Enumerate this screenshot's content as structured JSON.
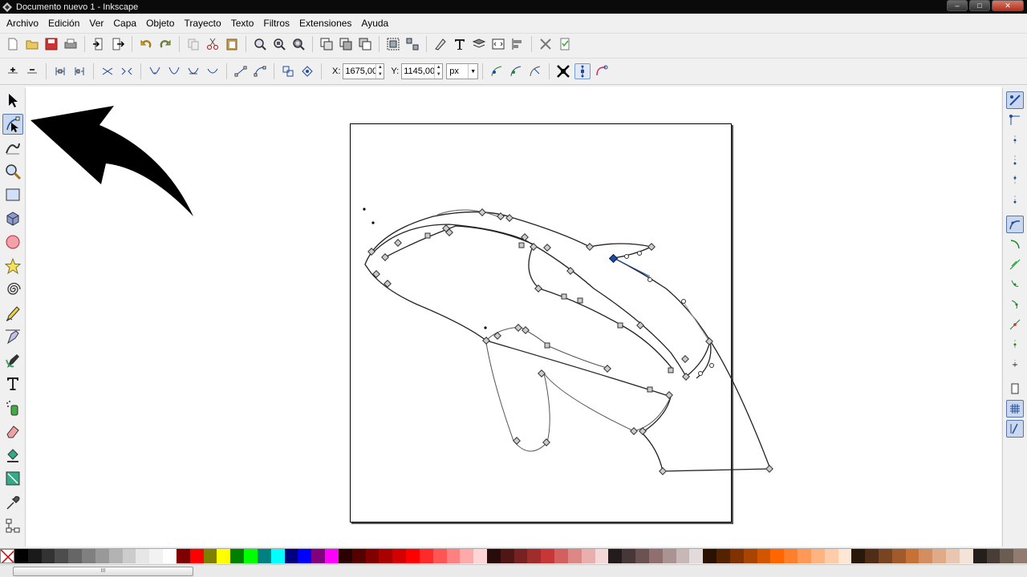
{
  "window": {
    "title": "Documento nuevo 1 - Inkscape",
    "minimize": "‒",
    "maximize": "□",
    "close": "✕"
  },
  "menu": [
    "Archivo",
    "Edición",
    "Ver",
    "Capa",
    "Objeto",
    "Trayecto",
    "Texto",
    "Filtros",
    "Extensiones",
    "Ayuda"
  ],
  "nodebar": {
    "x_label": "X:",
    "x_value": "1675,00",
    "y_label": "Y:",
    "y_value": "1145,00",
    "unit": "px"
  },
  "scrollbar": {
    "grip": "III"
  },
  "colors": {
    "accent": "#1f4a9e",
    "palette": [
      "#000000",
      "#1a1a1a",
      "#333333",
      "#4d4d4d",
      "#666666",
      "#808080",
      "#999999",
      "#b3b3b3",
      "#cccccc",
      "#e6e6e6",
      "#f2f2f2",
      "#ffffff",
      "#800000",
      "#ff0000",
      "#808000",
      "#ffff00",
      "#008000",
      "#00ff00",
      "#008080",
      "#00ffff",
      "#000080",
      "#0000ff",
      "#800080",
      "#ff00ff",
      "#2b0000",
      "#550000",
      "#800000",
      "#aa0000",
      "#d40000",
      "#ff0000",
      "#ff2a2a",
      "#ff5555",
      "#ff8080",
      "#ffaaaa",
      "#ffd5d5",
      "#280b0b",
      "#501616",
      "#782121",
      "#a02c2c",
      "#c83737",
      "#d35f5f",
      "#de8787",
      "#e9afaf",
      "#f4d7d7",
      "#241c1c",
      "#483737",
      "#6c5353",
      "#916f6f",
      "#ac9393",
      "#c8b7b7",
      "#e3dbdb",
      "#2b1100",
      "#552200",
      "#803300",
      "#aa4400",
      "#d45500",
      "#ff6600",
      "#ff7f2a",
      "#ff9955",
      "#ffb380",
      "#ffccaa",
      "#ffe6d5",
      "#28170b",
      "#502d16",
      "#784421",
      "#a05a2c",
      "#c87137",
      "#d38d5f",
      "#deaa87",
      "#e9c6af",
      "#f4e3d7",
      "#241f1c",
      "#483e37",
      "#6c5d53",
      "#917c6f"
    ]
  }
}
